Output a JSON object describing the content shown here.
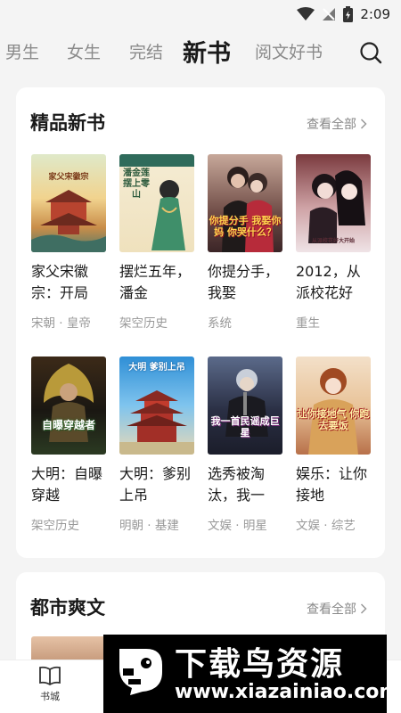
{
  "status": {
    "time": "2:09"
  },
  "tabs": [
    {
      "label": "男生"
    },
    {
      "label": "女生"
    },
    {
      "label": "完结"
    },
    {
      "label": "新书",
      "active": true
    },
    {
      "label": "阅文好书"
    }
  ],
  "sections": [
    {
      "title": "精品新书",
      "view_all": "查看全部",
      "books": [
        {
          "title": "家父宋徽宗：开局",
          "tag": "宋朝 · 皇帝",
          "cover_text": "家父宋徽宗"
        },
        {
          "title": "摆烂五年，潘金",
          "tag": "架空历史",
          "cover_text": "潘金莲摆上零山"
        },
        {
          "title": "你提分手，我娶",
          "tag": "系统",
          "cover_text": "你提分手 我娶你妈 你哭什么？"
        },
        {
          "title": "2012，从派校花好",
          "tag": "重生",
          "cover_text": "从派校花好大开始"
        },
        {
          "title": "大明：自曝穿越",
          "tag": "架空历史",
          "cover_text": "自曝穿越者"
        },
        {
          "title": "大明：爹别上吊",
          "tag": "明朝 · 基建",
          "cover_text": "大明 爹别上吊"
        },
        {
          "title": "选秀被淘汰，我一",
          "tag": "文娱 · 明星",
          "cover_text": "我一首民谣成巨星"
        },
        {
          "title": "娱乐：让你接地",
          "tag": "文娱 · 综艺",
          "cover_text": "让你接地气 你跑去要饭"
        }
      ]
    },
    {
      "title": "都市爽文",
      "view_all": "查看全部"
    }
  ],
  "bottom_nav": [
    {
      "label": "书城",
      "icon": "book-open-icon"
    }
  ],
  "watermark": {
    "title": "下载鸟资源",
    "url": "www.xiazainiao.com"
  },
  "colors": {
    "background": "#f4f4f4",
    "card": "#ffffff",
    "active_tab": "#1a1a1a",
    "inactive_tab": "#8a8a8a",
    "muted_text": "#999999"
  }
}
